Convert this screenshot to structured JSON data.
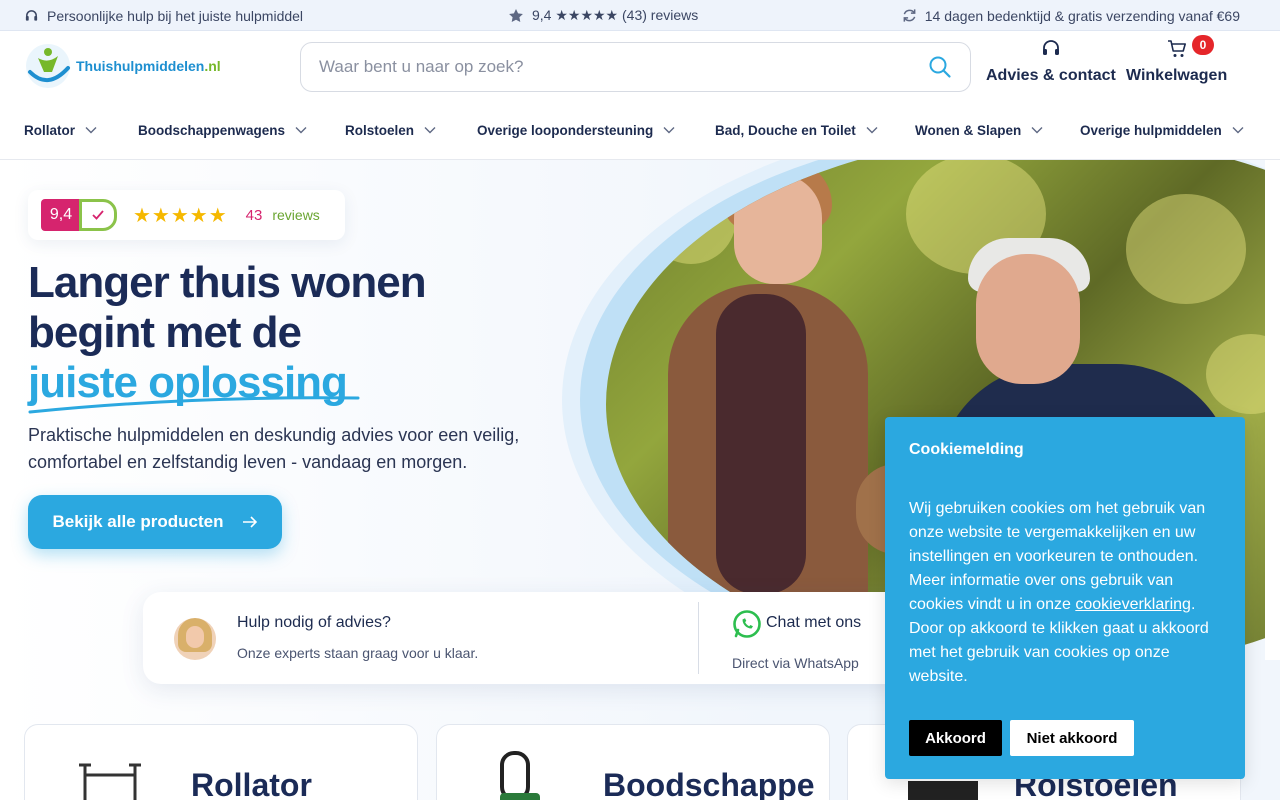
{
  "topbar": {
    "help_text": "Persoonlijke hulp bij het juiste hulpmiddel",
    "rating_text": "9,4 ★★★★★ (43) reviews",
    "shipping_text": "14 dagen bedenktijd & gratis verzending vanaf €69"
  },
  "header": {
    "logo_brand": "Thuishulpmiddelen",
    "logo_tld": ".nl",
    "search_placeholder": "Waar bent u naar op zoek?",
    "advice_label": "Advies & contact",
    "cart_label": "Winkelwagen",
    "cart_count": "0"
  },
  "nav": {
    "items": [
      {
        "label": "Rollator"
      },
      {
        "label": "Boodschappenwagens"
      },
      {
        "label": "Rolstoelen"
      },
      {
        "label": "Overige loopondersteuning"
      },
      {
        "label": "Bad, Douche en Toilet"
      },
      {
        "label": "Wonen & Slapen"
      },
      {
        "label": "Overige hulpmiddelen"
      }
    ]
  },
  "hero": {
    "rating_score": "9,4",
    "rating_stars": "★★★★★",
    "rating_count": "43",
    "rating_word": "reviews",
    "headline_line1": "Langer thuis wonen",
    "headline_line2": "begint met de",
    "headline_accent": "juiste oplossing",
    "subtext": "Praktische hulpmiddelen en deskundig advies voor een veilig, comfortabel en zelfstandig leven - vandaag en morgen.",
    "cta_label": "Bekijk alle producten",
    "cta_arrow": "→"
  },
  "help": {
    "title": "Hulp nodig of advies?",
    "subtitle": "Onze experts staan graag voor u klaar.",
    "chat_title": "Chat met ons",
    "chat_sub": "Direct via WhatsApp"
  },
  "categories": [
    {
      "title": "Rollator"
    },
    {
      "title": "Boodschappe"
    },
    {
      "title": "Rolstoelen"
    }
  ],
  "cookie": {
    "title": "Cookiemelding",
    "text_before": "Wij gebruiken cookies om het gebruik van onze website te vergemakkelijken en uw instellingen en voorkeuren te onthouden. Meer informatie over ons gebruik van cookies vindt u in onze ",
    "link": "cookieverklaring",
    "text_after": ". Door op akkoord te klikken gaat u akkoord met het gebruik van cookies op onze website.",
    "accept_label": "Akkoord",
    "decline_label": "Niet akkoord"
  },
  "colors": {
    "brand_blue": "#2ba8e0",
    "navy": "#1b2b57",
    "rating_pink": "#d6246e",
    "rating_green": "#8bc34a",
    "badge_red": "#e5262a"
  },
  "icons": [
    "headset-icon",
    "star-icon",
    "refresh-icon",
    "search-icon",
    "cart-icon",
    "chevron-down-icon",
    "check-icon",
    "arrow-right-icon",
    "whatsapp-icon"
  ]
}
